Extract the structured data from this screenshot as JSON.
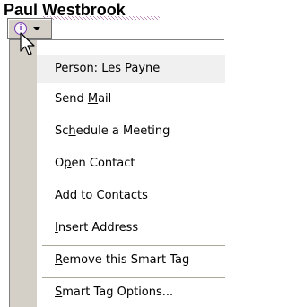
{
  "document": {
    "name_text": "Paul Westbrook"
  },
  "smart_tag": {
    "icon": "smart-tag-info-icon",
    "dropdown_icon": "chevron-down-icon",
    "accent_color": "#7b3fb0"
  },
  "menu": {
    "header": "Person: Les Payne",
    "items": [
      {
        "pre": "Send ",
        "mn": "M",
        "post": "ail"
      },
      {
        "pre": "Sc",
        "mn": "h",
        "post": "edule a Meeting"
      },
      {
        "pre": "O",
        "mn": "p",
        "post": "en Contact"
      },
      {
        "pre": "",
        "mn": "A",
        "post": "dd to Contacts"
      },
      {
        "pre": "",
        "mn": "I",
        "post": "nsert Address"
      },
      {
        "pre": "",
        "mn": "R",
        "post": "emove this Smart Tag"
      },
      {
        "pre": "",
        "mn": "S",
        "post": "mart Tag Options..."
      }
    ]
  }
}
